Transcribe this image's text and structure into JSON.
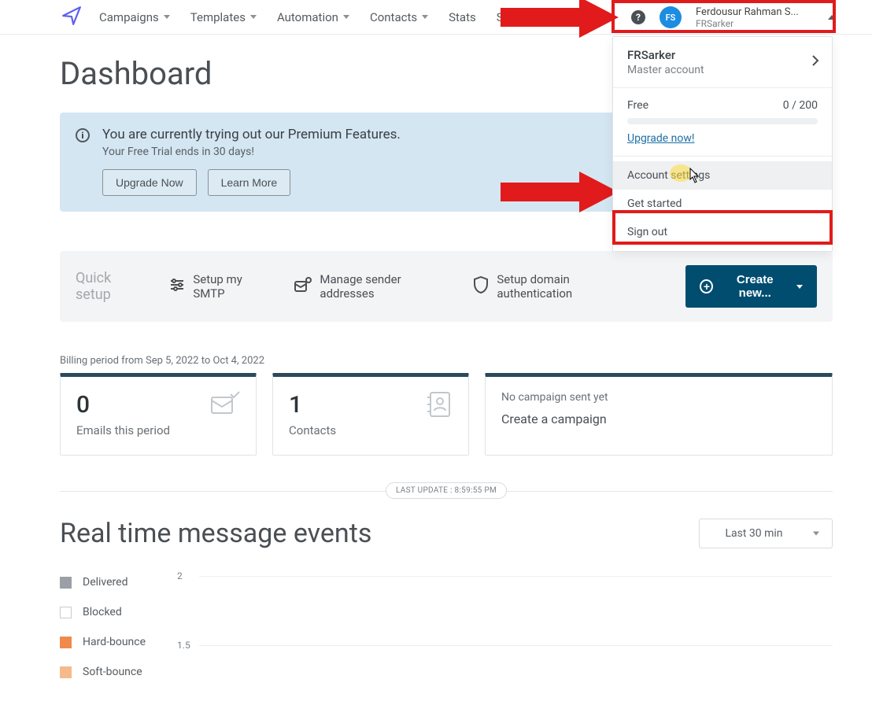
{
  "nav": {
    "items": [
      "Campaigns",
      "Templates",
      "Automation",
      "Contacts",
      "Stats",
      "SMS"
    ]
  },
  "user": {
    "initials": "FS",
    "display_name": "Ferdousur Rahman S...",
    "subtitle": "FRSarker",
    "help_glyph": "?"
  },
  "dropdown": {
    "account_name": "FRSarker",
    "account_type": "Master account",
    "plan_label": "Free",
    "plan_usage": "0 / 200",
    "upgrade_link": "Upgrade now!",
    "items": {
      "account_settings": "Account settings",
      "get_started": "Get started",
      "sign_out": "Sign out"
    }
  },
  "page": {
    "title": "Dashboard"
  },
  "banner": {
    "title": "You are currently trying out our Premium Features.",
    "subtitle": "Your Free Trial ends in 30 days!",
    "upgrade_btn": "Upgrade Now",
    "learn_btn": "Learn More"
  },
  "quicksetup": {
    "label": "Quick setup",
    "smtp": "Setup my SMTP",
    "sender": "Manage sender addresses",
    "domain": "Setup domain authentication",
    "create": "Create new..."
  },
  "billing": {
    "line": "Billing period from Sep 5, 2022 to Oct 4, 2022"
  },
  "cards": {
    "emails_value": "0",
    "emails_label": "Emails this period",
    "contacts_value": "1",
    "contacts_label": "Contacts",
    "campaign_text": "No campaign sent yet",
    "campaign_link": "Create a campaign"
  },
  "last_update": "LAST UPDATE : 8:59:55 PM",
  "realtime": {
    "title": "Real time message events",
    "range": "Last 30 min",
    "legend": {
      "delivered": "Delivered",
      "blocked": "Blocked",
      "hard_bounce": "Hard-bounce",
      "soft_bounce": "Soft-bounce"
    }
  },
  "chart_data": {
    "type": "line",
    "title": "Real time message events",
    "ylabel": "",
    "xlabel": "",
    "ylim": [
      0,
      2
    ],
    "y_ticks": [
      2,
      1.5
    ],
    "series": [
      {
        "name": "Delivered",
        "values": []
      },
      {
        "name": "Blocked",
        "values": []
      },
      {
        "name": "Hard-bounce",
        "values": []
      },
      {
        "name": "Soft-bounce",
        "values": []
      }
    ]
  }
}
